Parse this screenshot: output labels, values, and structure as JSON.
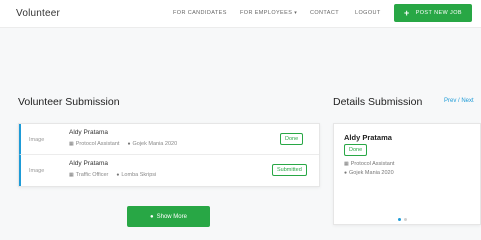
{
  "header": {
    "logo": "Volunteer",
    "nav": {
      "candidates": "FOR CANDIDATES",
      "employees": "FOR EMPLOYEES",
      "contact": "CONTACT",
      "logout": "LOGOUT"
    },
    "post_button": "POST NEW JOB"
  },
  "left": {
    "title": "Volunteer Submission",
    "rows": [
      {
        "image": "Image",
        "name": "Aldy Pratama",
        "role": "Protocol Assistant",
        "location": "Gojek Mania 2020",
        "status": "Done"
      },
      {
        "image": "Image",
        "name": "Aldy Pratama",
        "role": "Traffic Officer",
        "location": "Lomba Skripsi",
        "status": "Submitted"
      }
    ],
    "show_more": "Show More"
  },
  "right": {
    "title": "Details Submission",
    "prev_next": "Prev / Next",
    "card": {
      "name": "Aldy Pratama",
      "status": "Done",
      "role": "Protocol Assistant",
      "location": "Gojek Mania 2020"
    }
  },
  "colors": {
    "accent_green": "#28a745",
    "accent_blue": "#1e9bd7"
  }
}
